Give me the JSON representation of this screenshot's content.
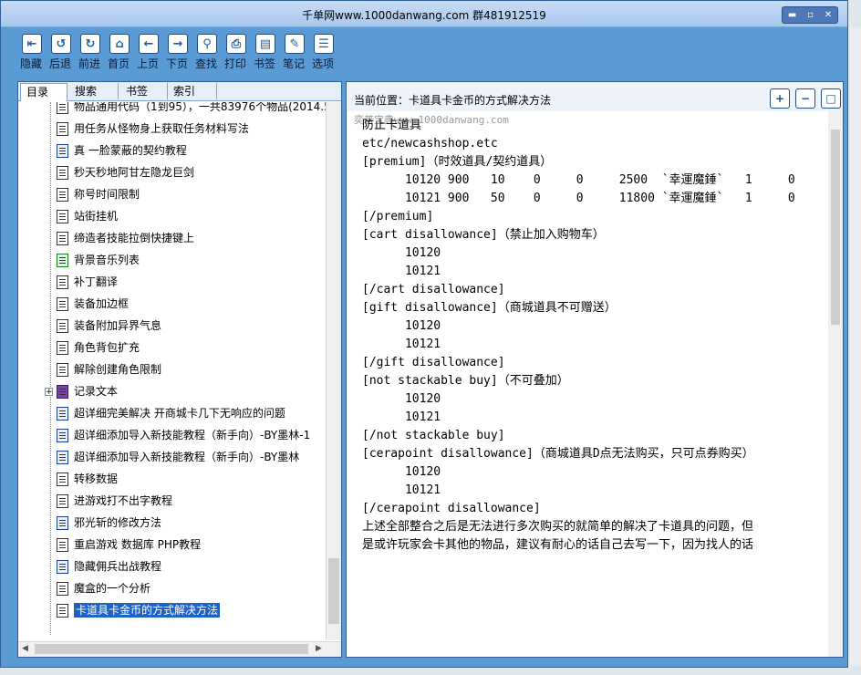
{
  "window": {
    "title": "千单网www.1000danwang.com 群481912519"
  },
  "toolbar": {
    "buttons": [
      {
        "label": "隐藏",
        "icon": "hide-icon",
        "glyph": "⇤"
      },
      {
        "label": "后退",
        "icon": "back-icon",
        "glyph": "↺"
      },
      {
        "label": "前进",
        "icon": "forward-icon",
        "glyph": "↻"
      },
      {
        "label": "首页",
        "icon": "home-icon",
        "glyph": "⌂"
      },
      {
        "label": "上页",
        "icon": "prev-page-icon",
        "glyph": "←"
      },
      {
        "label": "下页",
        "icon": "next-page-icon",
        "glyph": "→"
      },
      {
        "label": "查找",
        "icon": "search-icon",
        "glyph": "⚲"
      },
      {
        "label": "打印",
        "icon": "print-icon",
        "glyph": "⎙"
      },
      {
        "label": "书签",
        "icon": "bookmark-icon",
        "glyph": "▤"
      },
      {
        "label": "笔记",
        "icon": "note-icon",
        "glyph": "✎"
      },
      {
        "label": "选项",
        "icon": "options-icon",
        "glyph": "☰"
      }
    ]
  },
  "tabs": [
    "目录",
    "搜索",
    "书签",
    "索引"
  ],
  "tree": [
    {
      "text": "物品通用代码（1到95），一共83976个物品(2014.5",
      "icon": "doc"
    },
    {
      "text": "用任务从怪物身上获取任务材料写法",
      "icon": "doc"
    },
    {
      "text": "真 一脸蒙蔽的契约教程",
      "icon": "word"
    },
    {
      "text": "秒天秒地阿甘左隐龙巨剑",
      "icon": "doc"
    },
    {
      "text": "称号时间限制",
      "icon": "doc"
    },
    {
      "text": "站街挂机",
      "icon": "doc"
    },
    {
      "text": "缔造者技能拉倒快捷键上",
      "icon": "doc"
    },
    {
      "text": "背景音乐列表",
      "icon": "excel"
    },
    {
      "text": "补丁翻译",
      "icon": "doc"
    },
    {
      "text": "装备加边框",
      "icon": "doc"
    },
    {
      "text": "装备附加异界气息",
      "icon": "doc"
    },
    {
      "text": "角色背包扩充",
      "icon": "doc"
    },
    {
      "text": "解除创建角色限制",
      "icon": "doc"
    },
    {
      "text": "记录文本",
      "icon": "book"
    },
    {
      "text": "超详细完美解决 开商城卡几下无响应的问题",
      "icon": "word"
    },
    {
      "text": "超详细添加导入新技能教程（新手向）-BY墨林-1",
      "icon": "word"
    },
    {
      "text": "超详细添加导入新技能教程（新手向）-BY墨林",
      "icon": "word"
    },
    {
      "text": "转移数据",
      "icon": "doc"
    },
    {
      "text": "进游戏打不出字教程",
      "icon": "doc"
    },
    {
      "text": "邪光斩的修改方法",
      "icon": "word"
    },
    {
      "text": "重启游戏 数据库 PHP教程",
      "icon": "doc"
    },
    {
      "text": "隐藏佣兵出战教程",
      "icon": "word"
    },
    {
      "text": "魔盒的一个分析",
      "icon": "doc"
    },
    {
      "text": "卡道具卡金币的方式解决方法",
      "icon": "doc"
    }
  ],
  "location": {
    "label": "当前位置：卡道具卡金币的方式解决方法"
  },
  "zoom": {
    "in": "+",
    "out": "−"
  },
  "watermark": "奕普宝典www.1000danwang.com",
  "content_lines": [
    "防止卡道具",
    "etc/newcashshop.etc",
    "[premium]（时效道具/契约道具）",
    "      10120 900   10    0     0     2500  `幸運魔錘`   1     0",
    "",
    "      10121 900   50    0     0     11800 `幸運魔錘`   1     0",
    "",
    "[/premium]",
    "",
    "",
    "[cart disallowance]（禁止加入购物车）",
    "      10120",
    "      10121",
    "[/cart disallowance]",
    "",
    "[gift disallowance]（商城道具不可赠送）",
    "      10120",
    "      10121",
    "[/gift disallowance]",
    "",
    "[not stackable buy]（不可叠加）",
    "      10120",
    "      10121",
    "[/not stackable buy]",
    "[cerapoint disallowance]（商城道具D点无法购买，只可点券购买）",
    "      10120",
    "      10121",
    "[/cerapoint disallowance]",
    "上述全部整合之后是无法进行多次购买的就简单的解决了卡道具的问题，但",
    "是或许玩家会卡其他的物品，建议有耐心的话自己去写一下，因为找人的话"
  ]
}
